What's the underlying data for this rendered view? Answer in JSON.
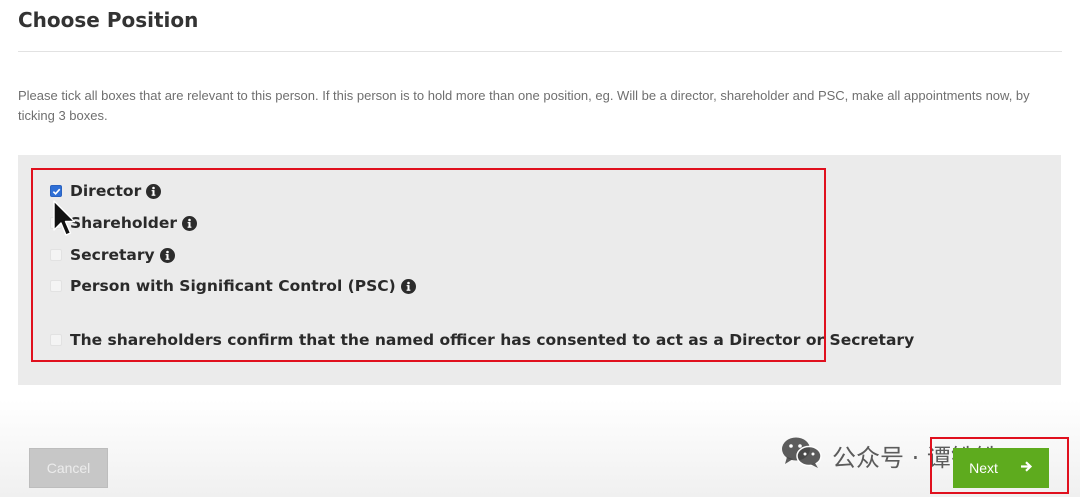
{
  "header": {
    "title": "Choose Position"
  },
  "intro_text": "Please tick all boxes that are relevant to this person. If this person is to hold more than one position, eg. Will be a director, shareholder and PSC, make all appointments now, by ticking 3 boxes.",
  "positions": [
    {
      "label": "Director",
      "checked": true,
      "has_info": true
    },
    {
      "label": "Shareholder",
      "checked": false,
      "has_info": true
    },
    {
      "label": "Secretary",
      "checked": false,
      "has_info": true
    },
    {
      "label": "Person with Significant Control (PSC)",
      "checked": false,
      "has_info": true
    },
    {
      "label": "The shareholders confirm that the named officer has consented to act as a Director or Secretary",
      "checked": false,
      "has_info": false
    }
  ],
  "buttons": {
    "cancel_label": "Cancel",
    "next_label": "Next"
  },
  "watermark": {
    "text": "公众号 · 谭铁铁",
    "icon": "wechat-icon"
  },
  "colors": {
    "highlight_red": "#e0101e",
    "next_green": "#5eab1e",
    "checkbox_blue": "#2f6fd6",
    "panel_gray": "#ebebeb"
  }
}
